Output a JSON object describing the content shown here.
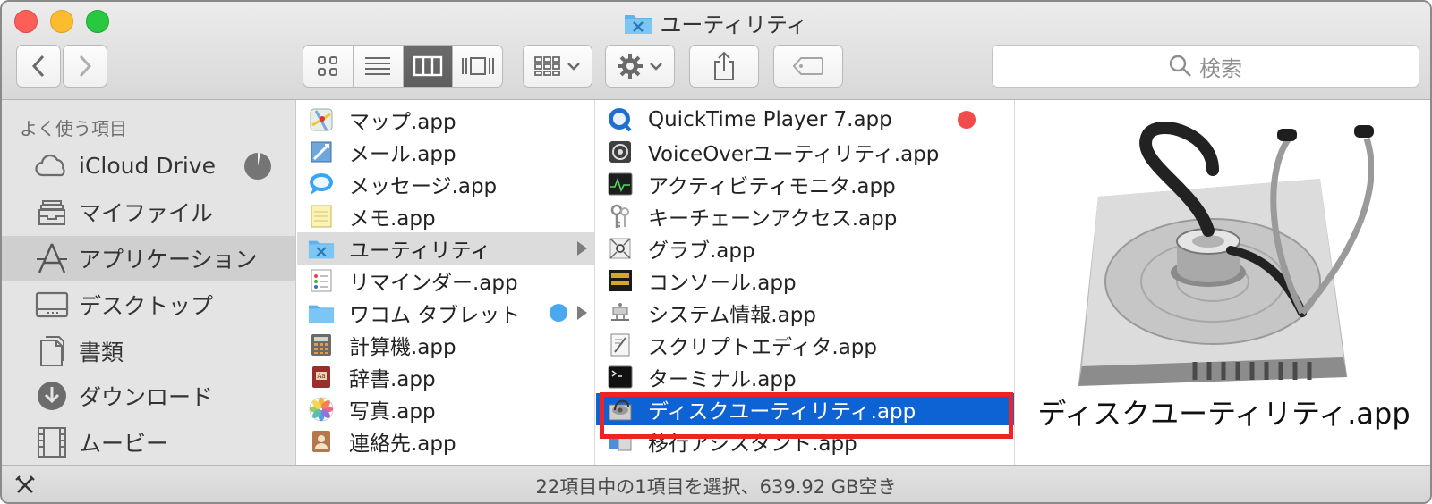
{
  "window": {
    "title": "ユーティリティ"
  },
  "toolbar": {
    "search_placeholder": "検索",
    "view_modes": [
      "icon",
      "list",
      "column",
      "cover-flow"
    ],
    "active_view": "column"
  },
  "sidebar": {
    "heading": "よく使う項目",
    "items": [
      {
        "label": "iCloud Drive",
        "icon": "cloud-icon"
      },
      {
        "label": "マイファイル",
        "icon": "all-my-files-icon"
      },
      {
        "label": "アプリケーション",
        "icon": "applications-icon",
        "selected": true
      },
      {
        "label": "デスクトップ",
        "icon": "desktop-icon"
      },
      {
        "label": "書類",
        "icon": "documents-icon"
      },
      {
        "label": "ダウンロード",
        "icon": "downloads-icon"
      },
      {
        "label": "ムービー",
        "icon": "movies-icon"
      }
    ]
  },
  "column1": {
    "items": [
      {
        "label": "マップ.app"
      },
      {
        "label": "メール.app"
      },
      {
        "label": "メッセージ.app"
      },
      {
        "label": "メモ.app"
      },
      {
        "label": "ユーティリティ",
        "folder": true,
        "highlighted": true
      },
      {
        "label": "リマインダー.app"
      },
      {
        "label": "ワコム タブレット",
        "folder": true
      },
      {
        "label": "計算機.app"
      },
      {
        "label": "辞書.app"
      },
      {
        "label": "写真.app"
      },
      {
        "label": "連絡先.app"
      }
    ]
  },
  "column2": {
    "items": [
      {
        "label": "QuickTime Player 7.app"
      },
      {
        "label": "VoiceOverユーティリティ.app"
      },
      {
        "label": "アクティビティモニタ.app"
      },
      {
        "label": "キーチェーンアクセス.app"
      },
      {
        "label": "グラブ.app"
      },
      {
        "label": "コンソール.app"
      },
      {
        "label": "システム情報.app"
      },
      {
        "label": "スクリプトエディタ.app"
      },
      {
        "label": "ターミナル.app"
      },
      {
        "label": "ディスクユーティリティ.app",
        "selected": true
      },
      {
        "label": "移行アシスタント.app"
      }
    ]
  },
  "preview": {
    "name": "ディスクユーティリティ.app"
  },
  "status": {
    "text": "22項目中の1項目を選択、639.92 GB空き"
  },
  "colors": {
    "selection": "#0d62d4",
    "red_tag": "#f24b4b",
    "blue_tag": "#4aa9ee",
    "annotation": "#ee2323"
  }
}
